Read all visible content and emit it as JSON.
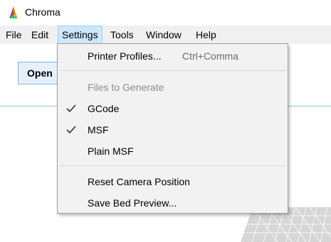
{
  "window": {
    "title": "Chroma",
    "icon": "chroma-logo-icon"
  },
  "menubar": {
    "items": [
      {
        "label": "File"
      },
      {
        "label": "Edit"
      },
      {
        "label": "Settings",
        "active": true
      },
      {
        "label": "Tools"
      },
      {
        "label": "Window"
      },
      {
        "label": "Help"
      }
    ]
  },
  "toolbar": {
    "open_label": "Open"
  },
  "settings_menu": {
    "printer_profiles": {
      "label": "Printer Profiles...",
      "shortcut": "Ctrl+Comma"
    },
    "files_header": {
      "label": "Files to Generate"
    },
    "gcode": {
      "label": "GCode",
      "checked": true
    },
    "msf": {
      "label": "MSF",
      "checked": true
    },
    "plain_msf": {
      "label": "Plain MSF",
      "checked": false
    },
    "reset_camera": {
      "label": "Reset Camera Position"
    },
    "save_bed_preview": {
      "label": "Save Bed Preview..."
    }
  },
  "colors": {
    "menu_highlight": "#cce8ff",
    "divider": "#8ecbe6",
    "menu_background": "#f2f2f2"
  }
}
